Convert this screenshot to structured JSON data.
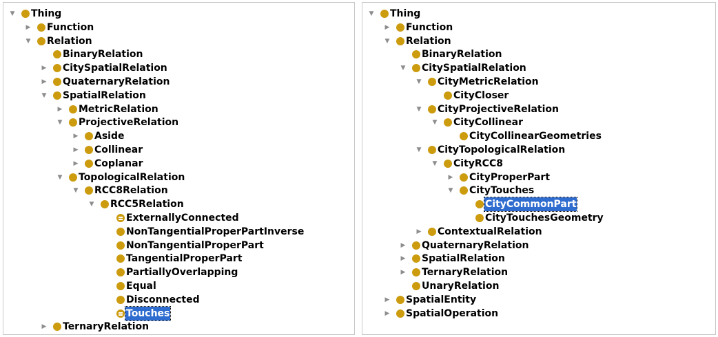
{
  "panels": [
    {
      "id": "left",
      "rows": [
        {
          "label": "Thing",
          "depth": 0,
          "toggle": "expanded"
        },
        {
          "label": "Function",
          "depth": 1,
          "toggle": "collapsed"
        },
        {
          "label": "Relation",
          "depth": 1,
          "toggle": "expanded"
        },
        {
          "label": "BinaryRelation",
          "depth": 2,
          "toggle": "none"
        },
        {
          "label": "CitySpatialRelation",
          "depth": 2,
          "toggle": "collapsed"
        },
        {
          "label": "QuaternaryRelation",
          "depth": 2,
          "toggle": "collapsed"
        },
        {
          "label": "SpatialRelation",
          "depth": 2,
          "toggle": "expanded"
        },
        {
          "label": "MetricRelation",
          "depth": 3,
          "toggle": "collapsed"
        },
        {
          "label": "ProjectiveRelation",
          "depth": 3,
          "toggle": "expanded"
        },
        {
          "label": "Aside",
          "depth": 4,
          "toggle": "collapsed"
        },
        {
          "label": "Collinear",
          "depth": 4,
          "toggle": "collapsed"
        },
        {
          "label": "Coplanar",
          "depth": 4,
          "toggle": "collapsed"
        },
        {
          "label": "TopologicalRelation",
          "depth": 3,
          "toggle": "expanded"
        },
        {
          "label": "RCC8Relation",
          "depth": 4,
          "toggle": "expanded"
        },
        {
          "label": "RCC5Relation",
          "depth": 5,
          "toggle": "expanded"
        },
        {
          "label": "ExternallyConnected",
          "depth": 6,
          "toggle": "none",
          "icon": "equivalent"
        },
        {
          "label": "NonTangentialProperPartInverse",
          "depth": 6,
          "toggle": "none"
        },
        {
          "label": "NonTangentialProperPart",
          "depth": 6,
          "toggle": "none"
        },
        {
          "label": "TangentialProperPart",
          "depth": 6,
          "toggle": "none"
        },
        {
          "label": "PartiallyOverlapping",
          "depth": 6,
          "toggle": "none"
        },
        {
          "label": "Equal",
          "depth": 6,
          "toggle": "none"
        },
        {
          "label": "Disconnected",
          "depth": 6,
          "toggle": "none"
        },
        {
          "label": "Touches",
          "depth": 6,
          "toggle": "none",
          "icon": "equivalent",
          "selected": true
        },
        {
          "label": "TernaryRelation",
          "depth": 2,
          "toggle": "collapsed"
        }
      ]
    },
    {
      "id": "right",
      "rows": [
        {
          "label": "Thing",
          "depth": 0,
          "toggle": "expanded"
        },
        {
          "label": "Function",
          "depth": 1,
          "toggle": "collapsed"
        },
        {
          "label": "Relation",
          "depth": 1,
          "toggle": "expanded"
        },
        {
          "label": "BinaryRelation",
          "depth": 2,
          "toggle": "none"
        },
        {
          "label": "CitySpatialRelation",
          "depth": 2,
          "toggle": "expanded"
        },
        {
          "label": "CityMetricRelation",
          "depth": 3,
          "toggle": "expanded"
        },
        {
          "label": "CityCloser",
          "depth": 4,
          "toggle": "none"
        },
        {
          "label": "CityProjectiveRelation",
          "depth": 3,
          "toggle": "expanded"
        },
        {
          "label": "CityCollinear",
          "depth": 4,
          "toggle": "expanded"
        },
        {
          "label": "CityCollinearGeometries",
          "depth": 5,
          "toggle": "none"
        },
        {
          "label": "CityTopologicalRelation",
          "depth": 3,
          "toggle": "expanded"
        },
        {
          "label": "CityRCC8",
          "depth": 4,
          "toggle": "expanded"
        },
        {
          "label": "CityProperPart",
          "depth": 5,
          "toggle": "collapsed"
        },
        {
          "label": "CityTouches",
          "depth": 5,
          "toggle": "expanded"
        },
        {
          "label": "CityCommonPart",
          "depth": 6,
          "toggle": "none",
          "selected": true
        },
        {
          "label": "CityTouchesGeometry",
          "depth": 6,
          "toggle": "none"
        },
        {
          "label": "ContextualRelation",
          "depth": 3,
          "toggle": "collapsed"
        },
        {
          "label": "QuaternaryRelation",
          "depth": 2,
          "toggle": "collapsed"
        },
        {
          "label": "SpatialRelation",
          "depth": 2,
          "toggle": "collapsed"
        },
        {
          "label": "TernaryRelation",
          "depth": 2,
          "toggle": "collapsed"
        },
        {
          "label": "UnaryRelation",
          "depth": 2,
          "toggle": "none"
        },
        {
          "label": "SpatialEntity",
          "depth": 1,
          "toggle": "collapsed"
        },
        {
          "label": "SpatialOperation",
          "depth": 1,
          "toggle": "collapsed"
        }
      ]
    }
  ],
  "colors": {
    "class_dot": "#cc9b0e",
    "selection_bg": "#2e6ccf",
    "arrow": "#8d8d8d"
  },
  "icons": {
    "expanded": "triangle-down-icon",
    "collapsed": "triangle-right-icon",
    "class": "class-circle-icon",
    "equivalent": "equivalent-class-icon"
  }
}
